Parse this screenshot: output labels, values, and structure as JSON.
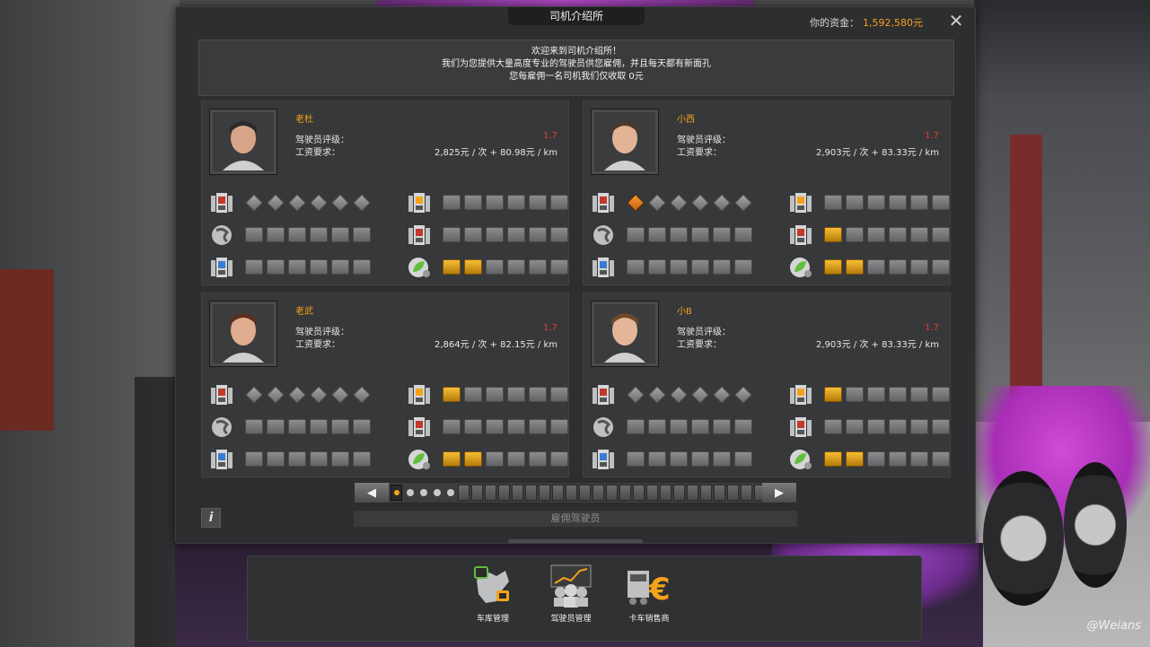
{
  "window": {
    "title": "司机介绍所",
    "funds_label": "你的资金：",
    "funds_value": "1,592,580元",
    "close_label": "✕"
  },
  "welcome": {
    "line1": "欢迎来到司机介绍所！",
    "line2": "我们为您提供大量高度专业的驾驶员供您雇佣，并且每天都有新面孔",
    "line3": "您每雇佣一名司机我们仅收取 0元"
  },
  "labels": {
    "rating": "驾驶员评级：",
    "salary": "工资要求："
  },
  "drivers": [
    {
      "name": "老杜",
      "rating": "1.7",
      "salary": "2,825元 / 次 + 80.98元 / km",
      "skills": {
        "adr": 0,
        "long_distance": 0,
        "high_value": 0,
        "fragile": 0,
        "urgent": 0,
        "eco": 2
      }
    },
    {
      "name": "小西",
      "rating": "1.7",
      "salary": "2,903元 / 次 + 83.33元 / km",
      "skills": {
        "adr": 1,
        "long_distance": 0,
        "high_value": 0,
        "fragile": 0,
        "urgent": 1,
        "eco": 2
      }
    },
    {
      "name": "老武",
      "rating": "1.7",
      "salary": "2,864元 / 次 + 82.15元 / km",
      "skills": {
        "adr": 0,
        "long_distance": 0,
        "high_value": 0,
        "fragile": 1,
        "urgent": 0,
        "eco": 2
      }
    },
    {
      "name": "小B",
      "rating": "1.7",
      "salary": "2,903元 / 次 + 83.33元 / km",
      "skills": {
        "adr": 0,
        "long_distance": 0,
        "high_value": 0,
        "fragile": 1,
        "urgent": 0,
        "eco": 2
      }
    }
  ],
  "pagination": {
    "prev": "◀",
    "next": "▶",
    "current_page": 1,
    "total_pages": 30
  },
  "hire_button": "雇佣驾驶员",
  "info_button": "i",
  "dock": [
    {
      "label": "车库管理",
      "icon": "garage-map-icon"
    },
    {
      "label": "驾驶员管理",
      "icon": "driver-chart-icon"
    },
    {
      "label": "卡车销售商",
      "icon": "truck-euro-icon"
    }
  ],
  "watermark": "@Weians",
  "colors": {
    "accent": "#f5a21b",
    "rating_red": "#e23b2e",
    "panel": "#2d2e30",
    "card": "#373839"
  }
}
